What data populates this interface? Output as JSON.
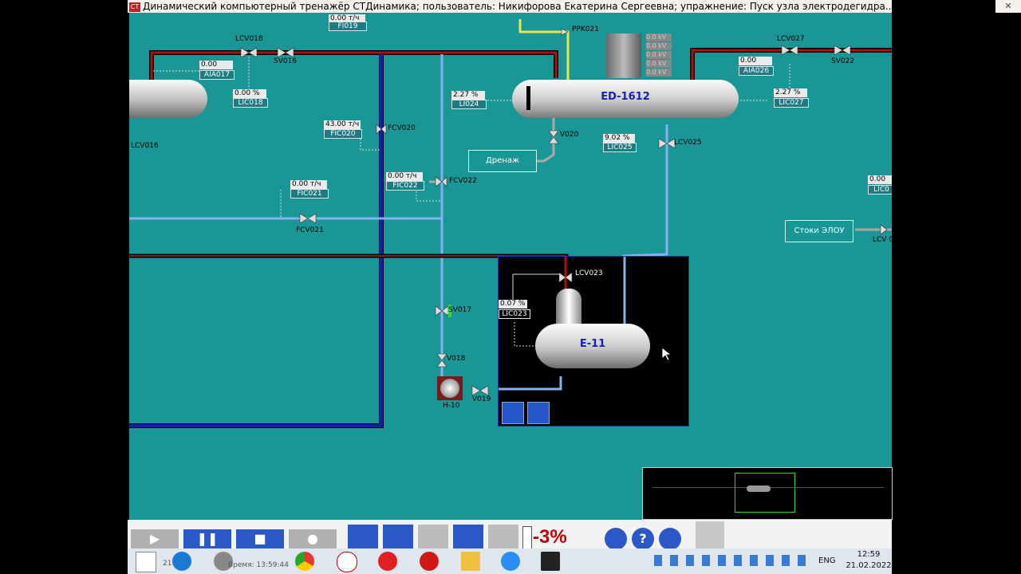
{
  "window": {
    "title": "Динамический компьютерный тренажёр СТДинамика; пользователь: Никифорова Екатерина Сергеевна; упражнение: Пуск узла электродегидра...",
    "app_icon": "СТ",
    "close": "✕"
  },
  "vessels": {
    "ed": "ED-1612",
    "e11": "E-11"
  },
  "equipment": {
    "lcv018": "LCV018",
    "sv016": "SV016",
    "lcv016": "LCV016",
    "fcv020": "FCV020",
    "fcv022": "FCV022",
    "fcv021": "FCV021",
    "ppk021": "PPK021",
    "v020": "V020",
    "lcv025": "LCV025",
    "lcv027": "LCV027",
    "sv022": "SV022",
    "lcv023": "LCV023",
    "sv017": "SV017",
    "v018": "V018",
    "v019": "V019",
    "h10": "H-10",
    "lcv_right": "LCV 0"
  },
  "instruments": {
    "fi019": {
      "tag": "FI019",
      "value": "0.00 т/ч"
    },
    "aia017": {
      "tag": "AIA017",
      "value": "0.00"
    },
    "lic018": {
      "tag": "LIC018",
      "value": "0.00 %"
    },
    "fic020": {
      "tag": "FIC020",
      "value": "43.00 т/ч"
    },
    "fic022": {
      "tag": "FIC022",
      "value": "0.00 т/ч"
    },
    "fic021": {
      "tag": "FIC021",
      "value": "0.00 т/ч"
    },
    "li024": {
      "tag": "LI024",
      "value": "2.27 %"
    },
    "lic025": {
      "tag": "LIC025",
      "value": "9.02 %"
    },
    "aia026": {
      "tag": "AIA026",
      "value": "0.00"
    },
    "lic027": {
      "tag": "LIC027",
      "value": "2.27 %"
    },
    "lic023": {
      "tag": "LIC023",
      "value": "0.07 %"
    },
    "lic_right": {
      "tag": "LIC0",
      "value": "0.00 %"
    }
  },
  "transformer_readings": [
    "0.0 kV",
    "0.0 kV",
    "0.0 kV",
    "0.0 kV",
    "0.0 kV"
  ],
  "labels": {
    "drain": "Дренаж",
    "elou": "Стоки ЭЛОУ"
  },
  "toolbar": {
    "speed": "-3%"
  },
  "taskbar": {
    "lang": "ENG",
    "time": "12:59",
    "date": "21.02.2022",
    "hidden_text_1": "21",
    "hidden_text_2": "Время: 13:59:44"
  },
  "colors": {
    "background": "#1a9696",
    "hot_line": "#b01010",
    "water_line": "#7fb4f0",
    "dark_line": "#1020a8",
    "accent_green": "#30d830"
  }
}
